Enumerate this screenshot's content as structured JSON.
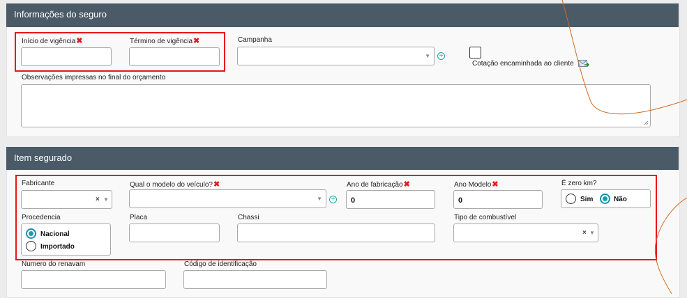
{
  "insurance": {
    "title": "Informações do seguro",
    "start_label": "Início de vigência",
    "end_label": "Término de vigência",
    "required_mark": "✖",
    "campaign_label": "Campanha",
    "forwarded_label": "Cotação encaminhada ao cliente",
    "notes_label": "Observações impressas no final do orçamento"
  },
  "item": {
    "title": "Item segurado",
    "manufacturer_label": "Fabricante",
    "model_label": "Qual o modelo do veículo?",
    "year_made_label": "Ano de fabricação",
    "year_made_value": "0",
    "year_model_label": "Ano Modelo",
    "year_model_value": "0",
    "zero_km_label": "É zero km?",
    "zero_km_options": [
      "Sim",
      "Não"
    ],
    "zero_km_selected": "Não",
    "origin_label": "Procedencia",
    "origin_options": [
      "Nacional",
      "Importado"
    ],
    "origin_selected": "Nacional",
    "plate_label": "Placa",
    "chassis_label": "Chassi",
    "fuel_label": "Tipo de combustível",
    "renavam_label": "Numero do renavam",
    "id_code_label": "Código de identificação"
  },
  "icons": {
    "clear": "×",
    "caret": "▼",
    "add": "+"
  },
  "colors": {
    "header_bg": "#4a5a66",
    "highlight": "#e8161a",
    "accent": "#16a0a8",
    "annotation_line": "#d2691e"
  }
}
